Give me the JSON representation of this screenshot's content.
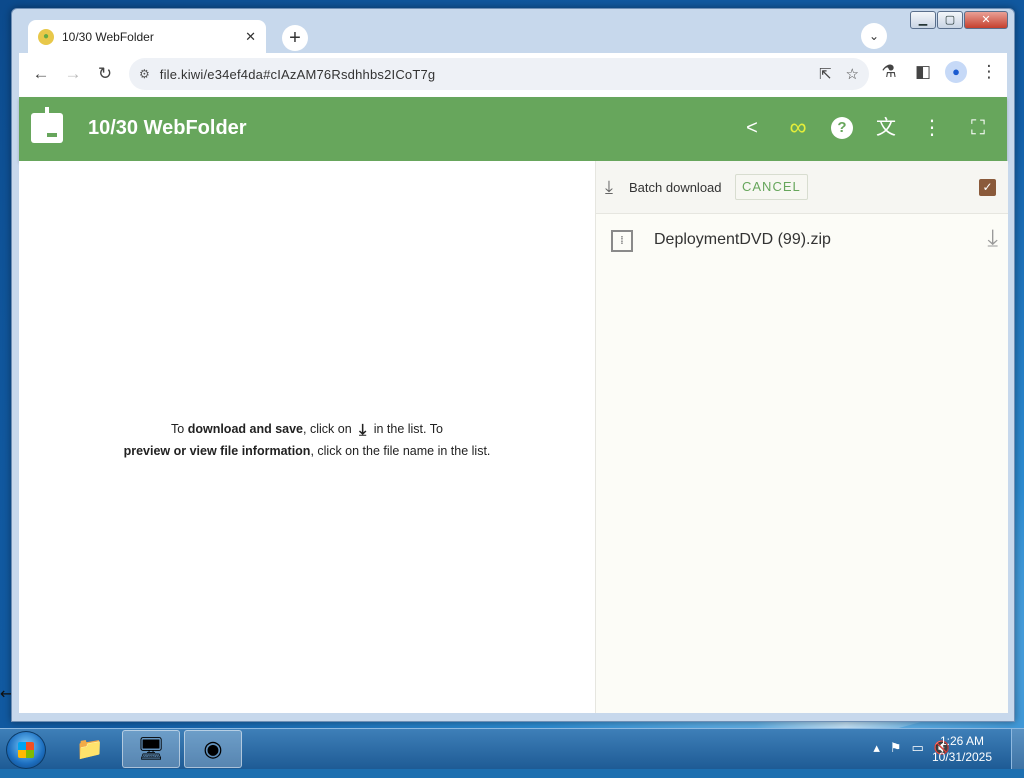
{
  "browser": {
    "tab": {
      "title": "10/30 WebFolder"
    },
    "address_bar": {
      "url": "file.kiwi/e34ef4da#cIAzAM76Rsdhhbs2ICoT7g"
    }
  },
  "app": {
    "title": "10/30 WebFolder",
    "accent_color": "#67a65c",
    "header_icons": [
      "share-icon",
      "infinity-icon",
      "help-icon",
      "translate-icon",
      "more-vert-icon",
      "fullscreen-icon"
    ]
  },
  "left_pane": {
    "instr_part1": "To ",
    "instr_bold1": "download and save",
    "instr_part2": ", click on",
    "instr_part3": "in the list. To",
    "instr_bold2": "preview or view file information",
    "instr_part4": ", click on the file name in the list."
  },
  "right_pane": {
    "batch_label": "Batch download",
    "cancel_label": "CANCEL",
    "select_all_checked": true,
    "files": [
      {
        "name": "DeploymentDVD (99).zip"
      }
    ]
  },
  "taskbar": {
    "apps": [
      "windows-explorer-icon",
      "control-panel-icon",
      "chrome-icon"
    ],
    "clock_time": "1:26 AM",
    "clock_date": "10/31/2025"
  }
}
